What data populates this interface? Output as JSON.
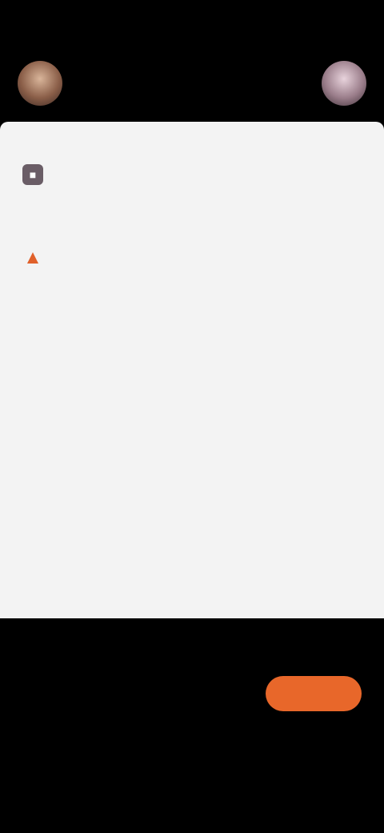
{
  "status_bar": {
    "time": "",
    "battery": ""
  },
  "header": {
    "title": "",
    "subtitle": ""
  },
  "card": {
    "title": "",
    "group1": {
      "title": "",
      "rows": [
        {
          "name": "",
          "value": ""
        }
      ]
    },
    "group2": {
      "title": "",
      "rows": [
        {
          "name": "",
          "value": ""
        },
        {
          "name": "",
          "value": ""
        },
        {
          "name": "",
          "value": ""
        },
        {
          "name": "",
          "value": ""
        },
        {
          "name": "",
          "value": ""
        },
        {
          "name": "",
          "value": ""
        }
      ]
    },
    "note": ""
  },
  "bottom": {
    "title": "",
    "rows": [
      {
        "label": "",
        "value": ""
      },
      {
        "label": "",
        "value": ""
      },
      {
        "label": "",
        "value": ""
      }
    ],
    "button_label": ""
  },
  "colors": {
    "accent": "#e8672a",
    "card_bg": "#f3f3f3",
    "page_bg": "#000000"
  }
}
